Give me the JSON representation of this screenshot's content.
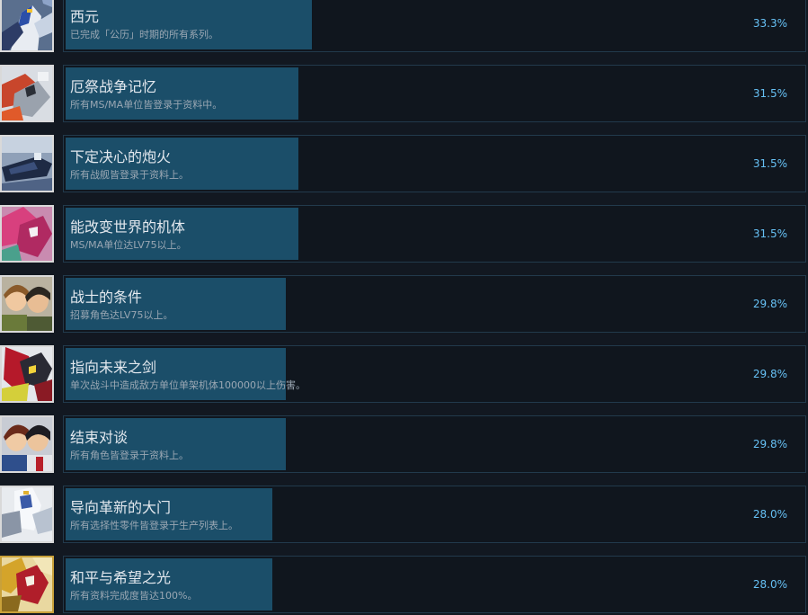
{
  "achievements": [
    {
      "title": "西元",
      "description": "已完成「公历」时期的所有系列。",
      "percent_text": "33.3%",
      "percent": 33.3,
      "icon": "gundam-exia-icon"
    },
    {
      "title": "厄祭战争记忆",
      "description": "所有MS/MA单位皆登录于资料中。",
      "percent_text": "31.5%",
      "percent": 31.5,
      "icon": "gundam-barbatos-icon"
    },
    {
      "title": "下定决心的炮火",
      "description": "所有战舰皆登录于资料上。",
      "percent_text": "31.5%",
      "percent": 31.5,
      "icon": "battleship-icon"
    },
    {
      "title": "能改变世界的机体",
      "description": "MS/MA单位达LV75以上。",
      "percent_text": "31.5%",
      "percent": 31.5,
      "icon": "gundam-pink-icon"
    },
    {
      "title": "战士的条件",
      "description": "招募角色达LV75以上。",
      "percent_text": "29.8%",
      "percent": 29.8,
      "icon": "pilots-portrait-icon"
    },
    {
      "title": "指向未来之剑",
      "description": "单次战斗中造成敌方单位单架机体100000以上伤害。",
      "percent_text": "29.8%",
      "percent": 29.8,
      "icon": "gundam-red-sword-icon"
    },
    {
      "title": "结束对谈",
      "description": "所有角色皆登录于资料上。",
      "percent_text": "29.8%",
      "percent": 29.8,
      "icon": "characters-portrait-icon"
    },
    {
      "title": "导向革新的大门",
      "description": "所有选择性零件皆登录于生产列表上。",
      "percent_text": "28.0%",
      "percent": 28.0,
      "icon": "gundam-white-icon"
    },
    {
      "title": "和平与希望之光",
      "description": "所有资料完成度皆达100%。",
      "percent_text": "28.0%",
      "percent": 28.0,
      "icon": "gundam-gold-icon"
    }
  ],
  "colors": {
    "background": "#121821",
    "bar": "#1b4e69",
    "percent_text": "#66c0f4",
    "title_text": "#e3e8ee",
    "description_text": "#9aa7b3"
  }
}
